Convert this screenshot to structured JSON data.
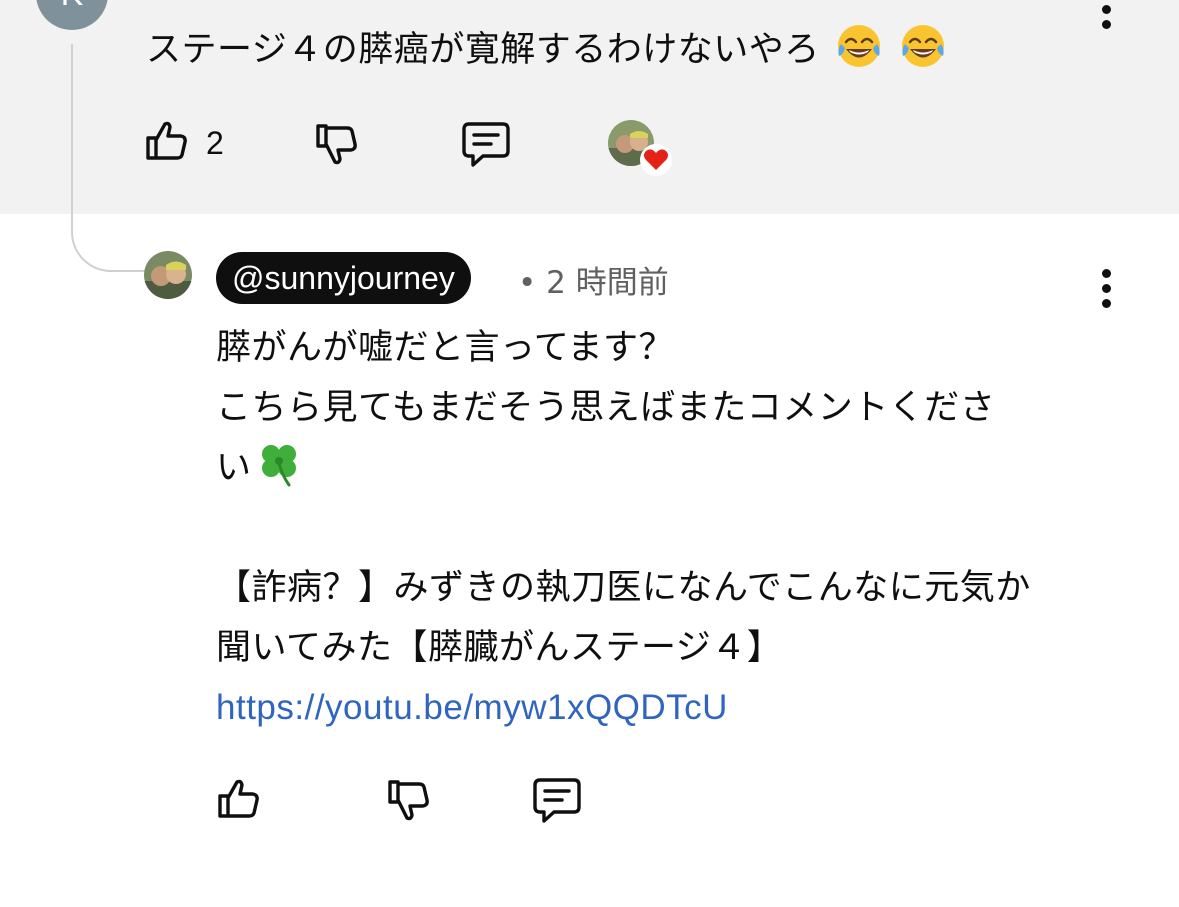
{
  "parent_comment": {
    "avatar_initial": "K",
    "text": "ステージ４の膵癌が寛解するわけないやろ",
    "emoji_icons": [
      "face-with-tears-of-joy-icon",
      "face-with-tears-of-joy-icon"
    ],
    "like_count": "2",
    "hearted_by_creator": true
  },
  "reply": {
    "handle": "@sunnyjourney",
    "meta": "• 2 時間前",
    "lines": [
      "膵がんが嘘だと言ってます？",
      "こちら見てもまだそう思えばまたコメントくださ",
      "い"
    ],
    "lines2": [
      "【詐病？】みずきの執刀医になんでこんなに元気か",
      "聞いてみた【膵臓がんステージ４】"
    ],
    "link": "https://youtu.be/myw1xQQDTcU",
    "trailing_emoji_icon": "four-leaf-clover-icon"
  },
  "colors": {
    "parent_background": "#f2f2f2",
    "link": "#2f65c0",
    "handle_pill": "#0f0f0f",
    "meta_text": "#606060",
    "heart": "#e62117"
  }
}
